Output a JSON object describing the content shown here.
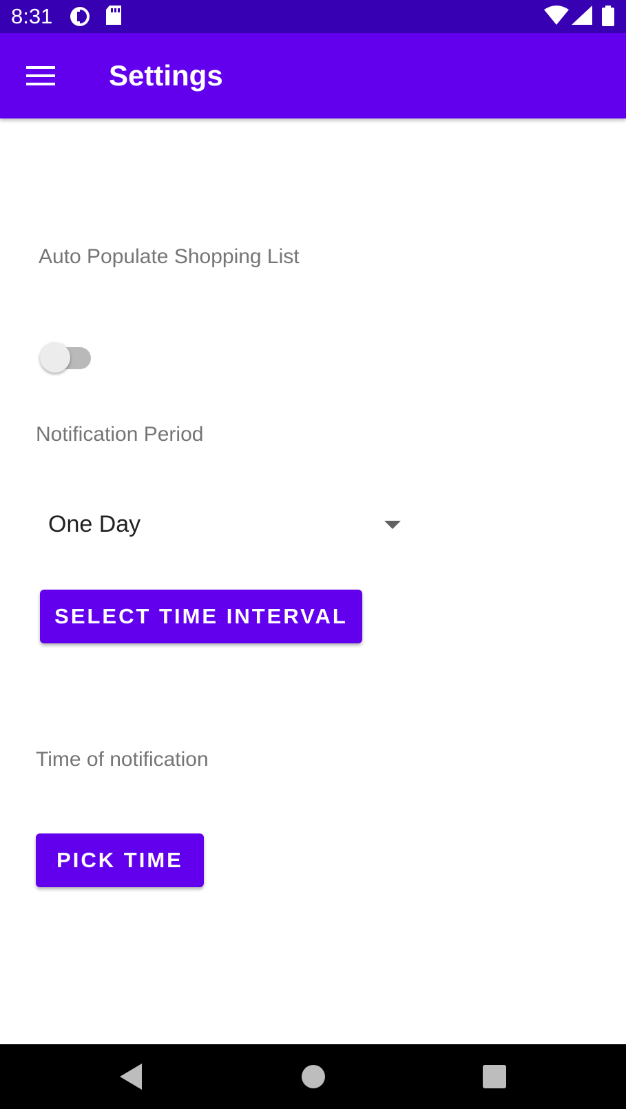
{
  "status_bar": {
    "time": "8:31",
    "icons": [
      "data-saver-icon",
      "sd-card-icon",
      "wifi-icon",
      "signal-icon",
      "battery-icon"
    ]
  },
  "app_bar": {
    "title": "Settings",
    "menu_icon": "hamburger-menu-icon",
    "color": "#6200ee"
  },
  "settings": {
    "auto_populate_label": "Auto Populate Shopping List",
    "auto_populate_enabled": false,
    "notification_period_label": "Notification Period",
    "notification_period_value": "One Day",
    "select_interval_button": "SELECT TIME INTERVAL",
    "time_of_notification_label": "Time of notification",
    "pick_time_button": "PICK TIME"
  },
  "nav_bar": {
    "icons": [
      "back-icon",
      "home-icon",
      "recents-icon"
    ]
  }
}
